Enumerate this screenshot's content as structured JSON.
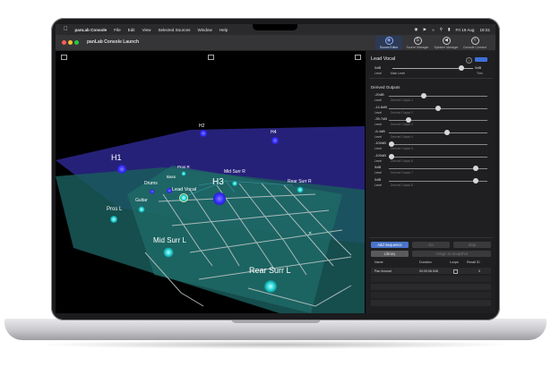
{
  "menubar": {
    "app": "panLab Console",
    "items": [
      "File",
      "Edit",
      "View",
      "Selected Sources",
      "Window",
      "Help"
    ],
    "date": "Fri 19 Aug",
    "time": "19:31"
  },
  "window": {
    "title": "panLab Console Launch",
    "tabs": [
      "Source Editor",
      "Source Manager",
      "Speaker Manager",
      "Console Connect"
    ]
  },
  "viewport": {
    "speaker_labels": [
      "H1",
      "H2",
      "H3",
      "H4",
      "Pros R",
      "Bass",
      "Mid Surr R",
      "Rear Surr R",
      "Drums",
      "Lead Vocal",
      "Guitar",
      "Pros L",
      "Mid Surr L",
      "Rear Surr L"
    ]
  },
  "panel": {
    "source_name": "Lead Vocal",
    "source_level": "0dB",
    "source_trim": "0dB",
    "level_label": "Level",
    "main_level_label": "Main Level",
    "trim_label": "Trim",
    "derived_outputs_title": "Derived Outputs",
    "derived_outputs": [
      {
        "value": "-20dB",
        "name": "Derived Output 1",
        "level": 0.35
      },
      {
        "value": "-14.8dB",
        "name": "Derived Output 2",
        "level": 0.5
      },
      {
        "value": "-39.7dB",
        "name": "Derived Output 3",
        "level": 0.18
      },
      {
        "value": "-6.4dB",
        "name": "Derived Output 4",
        "level": 0.6
      },
      {
        "value": "-100dB",
        "name": "Derived Output 5",
        "level": 0.0
      },
      {
        "value": "-100dB",
        "name": "Derived Output 6",
        "level": 0.0
      },
      {
        "value": "0dB",
        "name": "Derived Output 7",
        "level": 0.9
      },
      {
        "value": "0dB",
        "name": "Derived Output 8",
        "level": 0.9
      }
    ],
    "buttons": {
      "add_sequence": "Add Sequence",
      "go": "Go",
      "stop": "Stop",
      "library": "Library",
      "assign": "Assign to Snapshot"
    },
    "table": {
      "headers": [
        "Name",
        "Duration",
        "Loops",
        "Recall ID"
      ],
      "rows": [
        {
          "name": "Pan Around",
          "duration": "00:00:06.546",
          "loops": "",
          "recall_id": "0"
        }
      ]
    }
  }
}
